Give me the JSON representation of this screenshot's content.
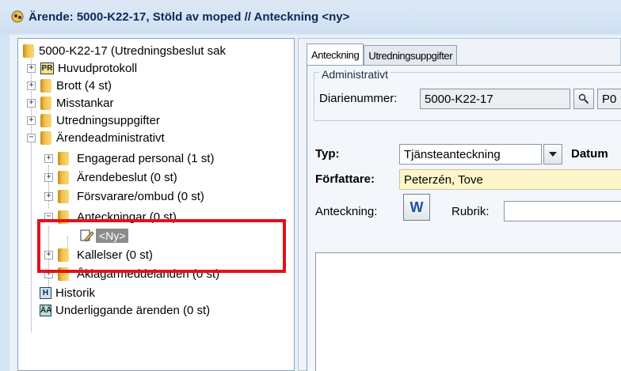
{
  "window": {
    "title": "Ärende: 5000-K22-17, Stöld av moped  //  Anteckning <ny>"
  },
  "tree": {
    "root": "5000-K22-17 (Utredningsbeslut sak",
    "items": [
      {
        "label": "Huvudprotokoll",
        "icon": "protocol-icon",
        "expander": "+"
      },
      {
        "label": "Brott (4 st)",
        "icon": "folder-icon",
        "expander": "+"
      },
      {
        "label": "Misstankar",
        "icon": "folder-icon",
        "expander": "+"
      },
      {
        "label": "Utredningsuppgifter",
        "icon": "folder-icon",
        "expander": "+"
      },
      {
        "label": "Ärendeadministrativt",
        "icon": "folder-icon",
        "expander": "−"
      },
      {
        "label": "Engagerad personal (1 st)",
        "icon": "folder-icon",
        "expander": "+"
      },
      {
        "label": "Ärendebeslut (0 st)",
        "icon": "folder-icon",
        "expander": "+"
      },
      {
        "label": "Försvarare/ombud (0 st)",
        "icon": "folder-icon",
        "expander": "+"
      },
      {
        "label": "Anteckningar (0 st)",
        "icon": "folder-icon",
        "expander": "−"
      },
      {
        "label": "<Ny>",
        "icon": "new-note-icon",
        "expander": ""
      },
      {
        "label": "Kallelser (0 st)",
        "icon": "folder-icon",
        "expander": "+"
      },
      {
        "label": "Åklagarmeddelanden (0 st)",
        "icon": "folder-icon",
        "expander": "+"
      },
      {
        "label": "Historik",
        "icon": "history-icon",
        "expander": ""
      },
      {
        "label": "Underliggande ärenden (0 st)",
        "icon": "sub-cases-icon",
        "expander": ""
      }
    ]
  },
  "tabs": [
    "Anteckning",
    "Utredningsuppgifter"
  ],
  "form": {
    "admin_legend": "Administrativt",
    "diarienummer_label": "Diarienummer:",
    "diarienummer_value": "5000-K22-17",
    "diarienummer_extra": "P0",
    "typ_label": "Typ:",
    "typ_value": "Tjänsteanteckning",
    "datum_label": "Datum",
    "forfattare_label": "Författare:",
    "forfattare_value": "Peterzén, Tove",
    "anteckning_label": "Anteckning:",
    "word_button": "W",
    "rubrik_label": "Rubrik:",
    "rubrik_value": ""
  }
}
